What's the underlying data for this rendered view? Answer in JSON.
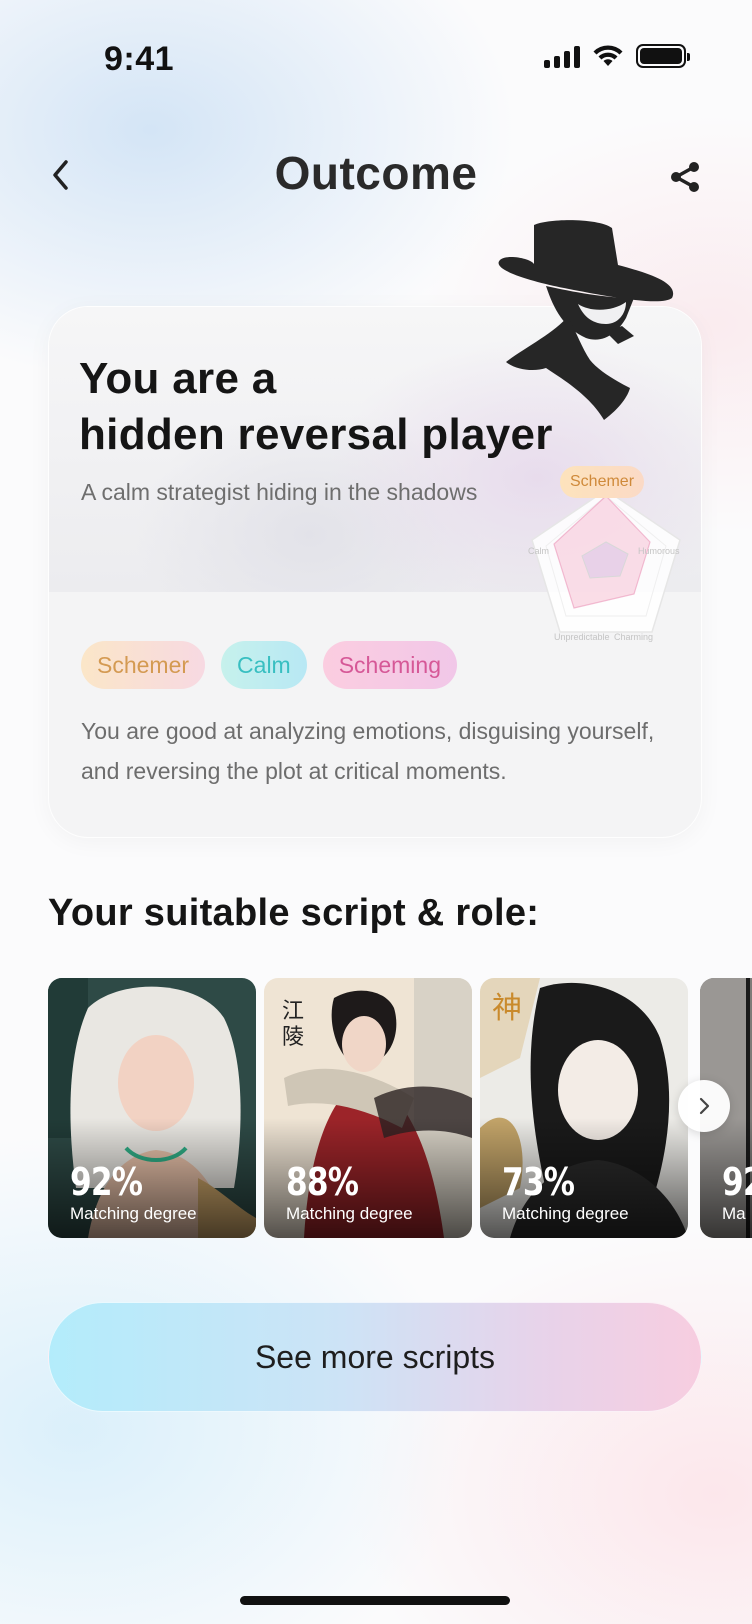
{
  "status_bar": {
    "time": "9:41"
  },
  "header": {
    "title": "Outcome"
  },
  "result": {
    "headline_line1": "You are a",
    "headline_line2": "hidden reversal player",
    "subtitle": "A calm strategist hiding in the shadows",
    "tags": [
      "Schemer",
      "Calm",
      "Scheming"
    ],
    "description": "You are good at analyzing emotions, disguising yourself, and reversing the plot at critical moments.",
    "radar": {
      "badge": "Schemer",
      "labels": [
        "Calm",
        "Humorous",
        "Unpredictable",
        "Charming"
      ]
    }
  },
  "recommendations": {
    "title": "Your suitable script & role:",
    "cards": [
      {
        "match": "92%",
        "label": "Matching degree"
      },
      {
        "match": "88%",
        "label": "Matching degree"
      },
      {
        "match": "73%",
        "label": "Matching degree"
      },
      {
        "match": "92",
        "label": "Ma"
      }
    ]
  },
  "cta": {
    "label": "See more scripts"
  },
  "icons": {
    "back": "chevron-left-icon",
    "share": "share-icon",
    "next": "chevron-right-icon",
    "illustration": "spy-icon"
  }
}
